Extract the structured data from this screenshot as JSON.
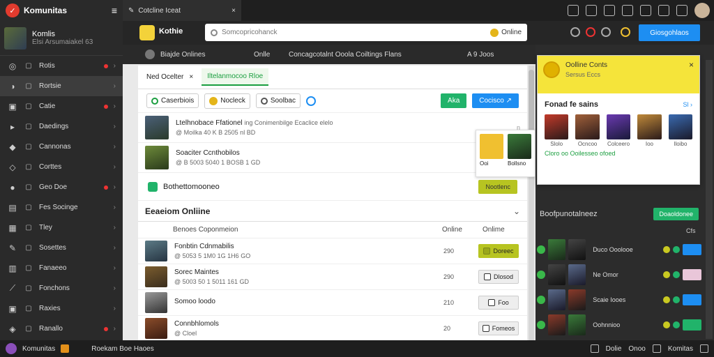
{
  "app": {
    "name": "Komunitas",
    "menu": "≡",
    "logo": "✓"
  },
  "profile": {
    "name": "Komlis",
    "sub": "Elsi Arsumaiakel 63"
  },
  "sidebar": {
    "items": [
      {
        "label": "Rotis",
        "dot": true
      },
      {
        "label": "Rortsie",
        "dot": false,
        "active": true
      },
      {
        "label": "Catie",
        "dot": true
      },
      {
        "label": "Daedings",
        "dot": false
      },
      {
        "label": "Cannonas",
        "dot": false
      },
      {
        "label": "Corttes",
        "dot": false
      },
      {
        "label": "Geo Doe",
        "dot": true
      },
      {
        "label": "Fes Socinge",
        "dot": false
      },
      {
        "label": "Tley",
        "dot": false
      },
      {
        "label": "Sosettes",
        "dot": false
      },
      {
        "label": "Fanaeeo",
        "dot": false
      },
      {
        "label": "Fonchons",
        "dot": false
      },
      {
        "label": "Raxies",
        "dot": false
      },
      {
        "label": "Ranallo",
        "dot": true
      }
    ]
  },
  "topbar": {
    "tab": "Cotcline Iceat",
    "close": "×",
    "tab_icon": "✎"
  },
  "header": {
    "app": "Kothie",
    "search_placeholder": "Somcopricohanck",
    "online": "Online",
    "button": "Giosgohlaos"
  },
  "subhead": {
    "title": "Biajde Onlines",
    "mid": "Onlle",
    "desc": "Concagcotalnt Ooola Coiltings Flans",
    "right": "A 9 Joos"
  },
  "main": {
    "tabs": {
      "tab_a": "Ned Ocelter",
      "close": "×",
      "tab_b": "Iltelanmocoo Rloe"
    },
    "chips": [
      "Caserbiois",
      "Nocleck",
      "Soolbac"
    ],
    "btn_green": "Aka",
    "btn_blue": "Cocisco ↗",
    "rows": [
      {
        "title": "Ltelhnobace Ffationel",
        "desc": "ing Conimenbilge Ecaclice elelo",
        "sub": "@ Moilka 40 K B 2505 nl BD",
        "num": "n"
      },
      {
        "title": "Soaciter Ccnthobilos",
        "desc": "",
        "sub": "@ B 5003 5040 1 BOSB 1 GD",
        "num": "n"
      }
    ],
    "stat": {
      "label": "Bothettomooneo",
      "btn": "Nootlenc"
    },
    "online_title": "Eeaeiom Onliine",
    "cols": {
      "name": "Benoes Coponmeion",
      "online": "Online",
      "status": "Onlime"
    },
    "orows": [
      {
        "title": "Fonbtin Cdnmabilis",
        "sub": "@ 5053 5 1M0 1G 1H6 GO",
        "count": "290",
        "action": "Doreec",
        "style": "y"
      },
      {
        "title": "Sorec Maintes",
        "sub": "@ 5003 50 1 5011 161 GD",
        "count": "290",
        "action": "Dlosod",
        "style": "g"
      },
      {
        "title": "Somoo loodo",
        "sub": "",
        "count": "210",
        "action": "Foo",
        "style": "g"
      },
      {
        "title": "Connbhlomols",
        "sub": "@ Cloel",
        "count": "20",
        "action": "Fomeos",
        "style": "g"
      }
    ]
  },
  "float": {
    "labels": [
      "Ooi",
      "Bollsno"
    ]
  },
  "ypanel": {
    "title": "Oolline Conts",
    "sub": "Sersus Eccs",
    "close": "×",
    "section": "Fonad fe sains",
    "link": "Sl ›",
    "heroes": [
      "Slolo",
      "Ocncoo",
      "Colceero",
      "Ioo",
      "Iloibo"
    ],
    "more": "Cloro oo Ooilesseo ofoed"
  },
  "rpanel": {
    "title": "Boofpunotalneez",
    "btn": "Doaoldonee",
    "sub": "Cfs",
    "rows": [
      {
        "name": "Duco Ooolooe",
        "action_style": "b"
      },
      {
        "name": "Ne Omor",
        "action_style": "p"
      },
      {
        "name": "Scaie Iooes",
        "action_style": "b"
      },
      {
        "name": "Oohnnioo",
        "action_style": "g"
      }
    ]
  },
  "footer": {
    "left": "Komunitas",
    "mid": "Roekam Boe Haoes",
    "r1": "Dolie",
    "r2": "Onoo",
    "r3": "Komitas"
  },
  "colors": {
    "accent": "#1d8ef2",
    "green": "#21b36a",
    "yellow": "#f5e43a"
  }
}
